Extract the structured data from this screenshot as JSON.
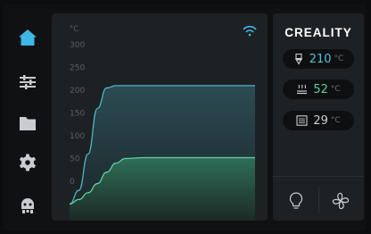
{
  "nav": {
    "items": [
      {
        "icon": "home-icon",
        "active": true
      },
      {
        "icon": "sliders-icon",
        "active": false
      },
      {
        "icon": "folder-icon",
        "active": false
      },
      {
        "icon": "gear-icon",
        "active": false
      },
      {
        "icon": "robot-icon",
        "active": false
      }
    ]
  },
  "chart_data": {
    "type": "area",
    "ylabel": "°C",
    "ylim": [
      0,
      300
    ],
    "yticks": [
      "300",
      "250",
      "200",
      "150",
      "100",
      "50",
      "0"
    ],
    "series": [
      {
        "color": "#4fb3c4",
        "fill": "#2a4950",
        "x": [
          0,
          5,
          10,
          15,
          20,
          25,
          30,
          40,
          50,
          100
        ],
        "values": [
          -50,
          -20,
          60,
          160,
          205,
          210,
          210,
          210,
          210,
          210
        ]
      },
      {
        "color": "#5fd0a0",
        "fill": "#2b6552",
        "x": [
          0,
          5,
          10,
          15,
          20,
          25,
          30,
          40,
          50,
          100
        ],
        "values": [
          -50,
          -40,
          -25,
          -5,
          20,
          40,
          50,
          52,
          52,
          52
        ]
      }
    ],
    "grid": false,
    "wifi_icon": "wifi-icon"
  },
  "side": {
    "brand": "CREALITY",
    "nozzle": {
      "icon": "nozzle-icon",
      "value": "210",
      "unit": "°C",
      "color": "#4fc3d9"
    },
    "bed": {
      "icon": "bed-icon",
      "value": "52",
      "unit": "°C",
      "color": "#5fd0a0"
    },
    "chamber": {
      "icon": "chamber-icon",
      "value": "29",
      "unit": "°C",
      "color": "#c9ccd1"
    },
    "buttons": [
      {
        "icon": "lightbulb-icon"
      },
      {
        "icon": "fan-icon"
      }
    ]
  },
  "colors": {
    "accent": "#3fb7e5",
    "panel": "#1e2124",
    "background": "#101113"
  }
}
